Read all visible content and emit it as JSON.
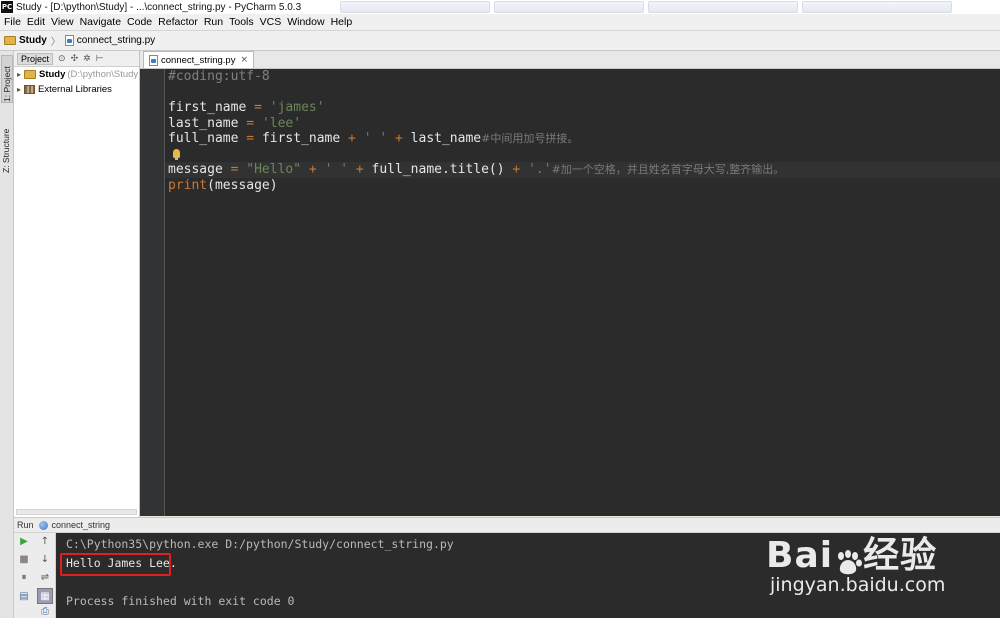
{
  "window": {
    "title": "Study - [D:\\python\\Study] - ...\\connect_string.py - PyCharm 5.0.3",
    "app_icon": "PC"
  },
  "menu": [
    "File",
    "Edit",
    "View",
    "Navigate",
    "Code",
    "Refactor",
    "Run",
    "Tools",
    "VCS",
    "Window",
    "Help"
  ],
  "navbar": {
    "project": "Study",
    "file": "connect_string.py"
  },
  "left_strip": {
    "project_tab": "1: Project",
    "structure_tab": "Z: Structure"
  },
  "project_panel": {
    "header": "Project",
    "root_name": "Study",
    "root_path": "(D:\\python\\Study",
    "libraries": "External Libraries"
  },
  "editor": {
    "tab_label": "connect_string.py",
    "lines": {
      "l1": "#coding:utf-8",
      "l3_var": "first_name",
      "l3_str": "'james'",
      "l4_var": "last_name",
      "l4_str": "'lee'",
      "l5_var": "full_name",
      "l5_a": "first_name",
      "l5_str": "' '",
      "l5_b": "last_name",
      "l5_cmt": "#中间用加号拼接。",
      "l7_var": "message",
      "l7_str1": "\"Hello\"",
      "l7_str2": "' '",
      "l7_call": "full_name.title()",
      "l7_str3": "'.'",
      "l7_cmt": "#加一个空格，并且姓名首字母大写,整齐输出。",
      "l8_kw": "print",
      "l8_arg": "(message)"
    }
  },
  "run": {
    "label": "Run",
    "config": "connect_string",
    "console": {
      "command": "C:\\Python35\\python.exe D:/python/Study/connect_string.py",
      "output": "Hello James Lee.",
      "exit": "Process finished with exit code 0"
    }
  },
  "watermark": {
    "brand_left": "Bai",
    "brand_right": "经验",
    "url": "jingyan.baidu.com"
  },
  "colors": {
    "editor_bg": "#2b2b2b",
    "string": "#6a8759",
    "operator": "#cc7832",
    "comment": "#808080",
    "highlight_box": "#e02020"
  }
}
